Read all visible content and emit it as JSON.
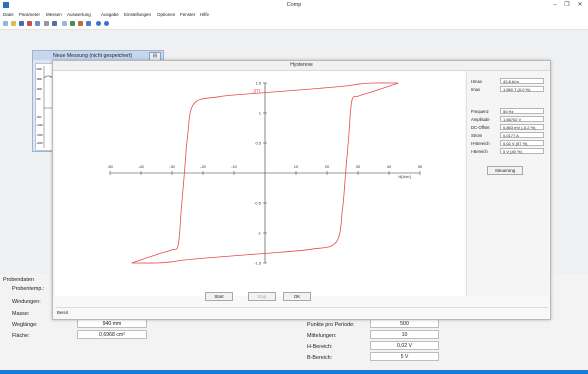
{
  "window": {
    "title": "Comp",
    "minimize": "–",
    "maximize": "❐",
    "close": "✕"
  },
  "menu": [
    "Datei",
    "Parameter",
    "Messen",
    "Auswertung",
    "Ausgabe",
    "Einstellungen",
    "Optionen",
    "Fenster",
    "Hilfe"
  ],
  "toolbar_icons": [
    "new-icon",
    "open-icon",
    "save-icon",
    "settings-icon",
    "edit-icon",
    "info-icon",
    "undo-icon",
    "grid-icon",
    "table-icon",
    "chart-icon",
    "export-icon",
    "play-icon",
    "help-icon"
  ],
  "back_window": {
    "title": "Neue Messung (nicht gespeichert)",
    "close": "⊟",
    "axis_ticks": [
      "2000",
      "1500",
      "1000",
      "500",
      "-500",
      "-1000",
      "-1500",
      "-2000"
    ]
  },
  "dialog": {
    "title": "Hysterese",
    "status": "Bereit",
    "buttons": {
      "start": "Start",
      "stop": "Stop",
      "ok": "OK"
    },
    "params": [
      {
        "label": "Hmax",
        "value": "42,8 A/m"
      },
      {
        "label": "Imax",
        "value": "1,560 T (0,0 %)"
      },
      {
        "label": "Frequenz",
        "value": "50 Hz"
      },
      {
        "label": "Amplitude",
        "value": "1,56702 V"
      },
      {
        "label": "DC-Offset",
        "value": "0,863 mV (-0,2 %)"
      },
      {
        "label": "Strom",
        "value": "0,0177 A"
      },
      {
        "label": "H-Bereich",
        "value": "0,02 V  (57 %)"
      },
      {
        "label": "I-Bereich",
        "value": "5 V  (40 %)"
      }
    ],
    "control_button": "Steuerung"
  },
  "chart_data": {
    "type": "line",
    "title": "",
    "xlabel": "H[A/m]",
    "ylabel": "J[T]",
    "xlim": [
      -50,
      50
    ],
    "ylim": [
      -1.5,
      1.5
    ],
    "x_ticks": [
      -50,
      -40,
      -30,
      -20,
      -10,
      10,
      20,
      30,
      40,
      50
    ],
    "y_ticks": [
      1.5,
      1,
      0.5,
      -0.5,
      -1,
      -1.5
    ],
    "x_tick_labels": [
      "-50",
      "-40",
      "-30",
      "-20",
      "-10",
      "10",
      "20",
      "30",
      "40",
      "50"
    ],
    "y_tick_labels": [
      "1.5",
      "1",
      "0.5",
      "-0.5",
      "-1",
      "-1.5"
    ],
    "series": [
      {
        "color": "#e84a4a",
        "x": [
          -43,
          -35,
          -30,
          -28,
          -27,
          -26,
          -25,
          -23,
          -15,
          0,
          15,
          26,
          30,
          35,
          43
        ],
        "y": [
          -1.5,
          -1.36,
          -1.28,
          -1.2,
          -0.6,
          0.0,
          0.6,
          1.15,
          1.27,
          1.34,
          1.4,
          1.45,
          1.48,
          1.5,
          1.5
        ]
      },
      {
        "color": "#e84a4a",
        "x": [
          43,
          35,
          30,
          28,
          27,
          26,
          25,
          23,
          15,
          0,
          -15,
          -26,
          -30,
          -35,
          -43
        ],
        "y": [
          1.5,
          1.36,
          1.28,
          1.2,
          0.6,
          0.0,
          -0.6,
          -1.15,
          -1.27,
          -1.34,
          -1.4,
          -1.45,
          -1.48,
          -1.5,
          -1.5
        ]
      }
    ]
  },
  "form": {
    "section": "Probendaten",
    "rows_left": [
      {
        "label": "Probentemp.:",
        "value": ""
      },
      {
        "label": "Windungen:",
        "value": ""
      },
      {
        "label": "Masse:",
        "value": ""
      },
      {
        "label": "Weglänge:",
        "value": "940 mm"
      },
      {
        "label": "Fläche:",
        "value": "0,6968 cm²"
      }
    ],
    "rows_right": [
      {
        "label": "Punkte pro Periode:",
        "value": "500"
      },
      {
        "label": "Mittelungen:",
        "value": "10"
      },
      {
        "label": "H-Bereich:",
        "value": "0,02 V"
      },
      {
        "label": "B-Bereich:",
        "value": "5 V"
      }
    ]
  },
  "colors": {
    "accent": "#1b78d4",
    "curve": "#e84a4a"
  }
}
